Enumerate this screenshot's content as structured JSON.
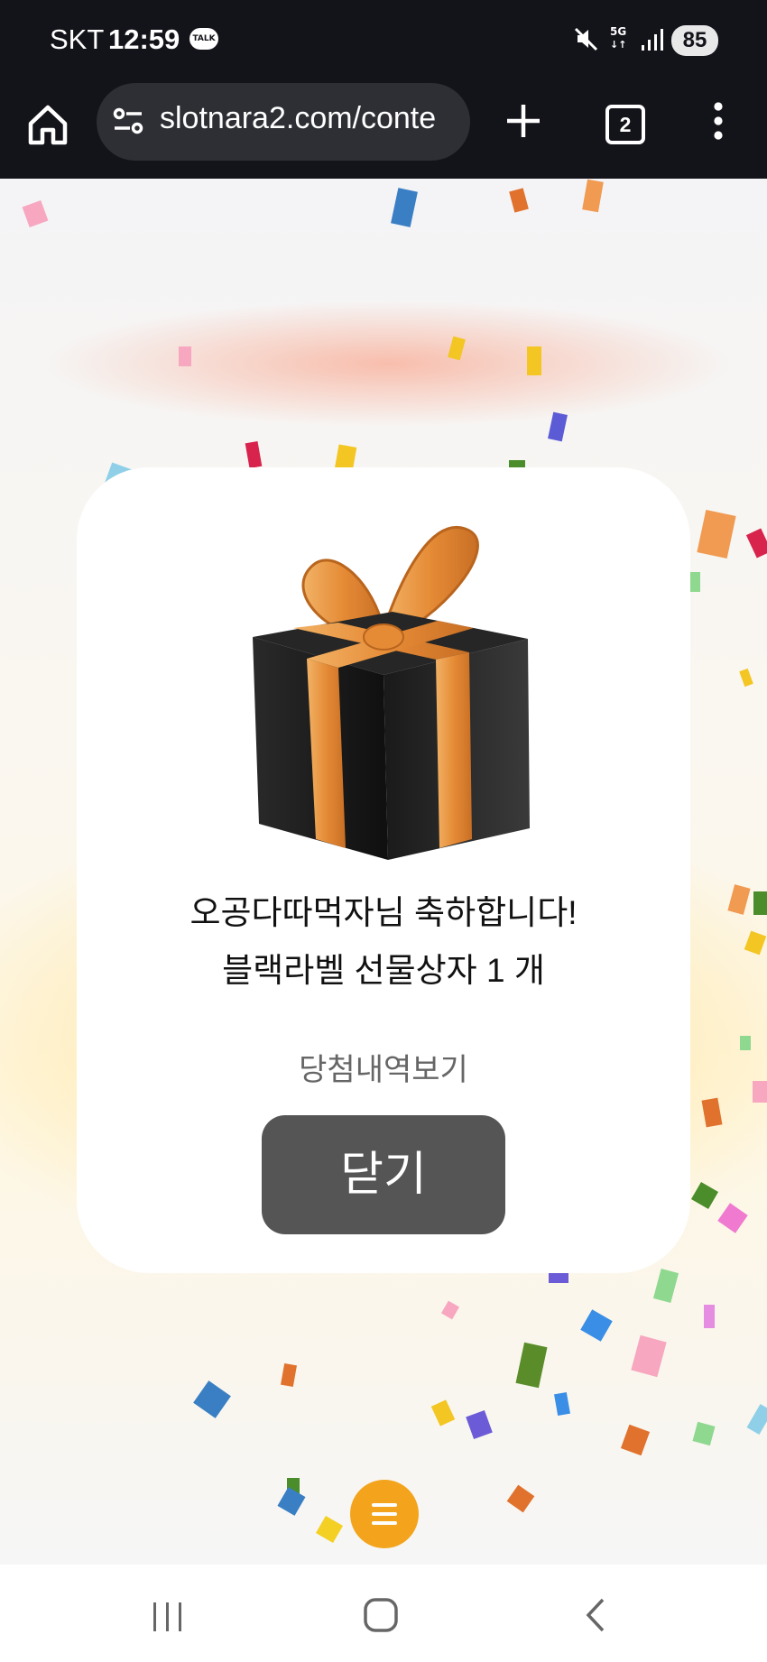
{
  "status_bar": {
    "carrier": "SKT",
    "time": "12:59",
    "chat_badge": "TALK",
    "network": "5G",
    "battery": "85"
  },
  "browser": {
    "url": "slotnara2.com/conte",
    "tab_count": "2"
  },
  "dialog": {
    "message_line1": "오공다따먹자님 축하합니다!",
    "message_line2": "블랙라벨 선물상자 1 개",
    "history_link": "당첨내역보기",
    "close_button": "닫기"
  },
  "colors": {
    "status_bar_bg": "#13131a",
    "close_button_bg": "#555555",
    "fab_bg": "#f3a41c",
    "gift_box": "#1b1b1b",
    "ribbon": "#e9953d"
  },
  "icons": {
    "home": "home-icon",
    "site_settings": "tune-icon",
    "new_tab": "plus-icon",
    "more": "more-vert-icon",
    "fab": "hamburger-menu-icon",
    "nav_recents": "recents-icon",
    "nav_home": "home-circle-icon",
    "nav_back": "back-chevron-icon"
  }
}
